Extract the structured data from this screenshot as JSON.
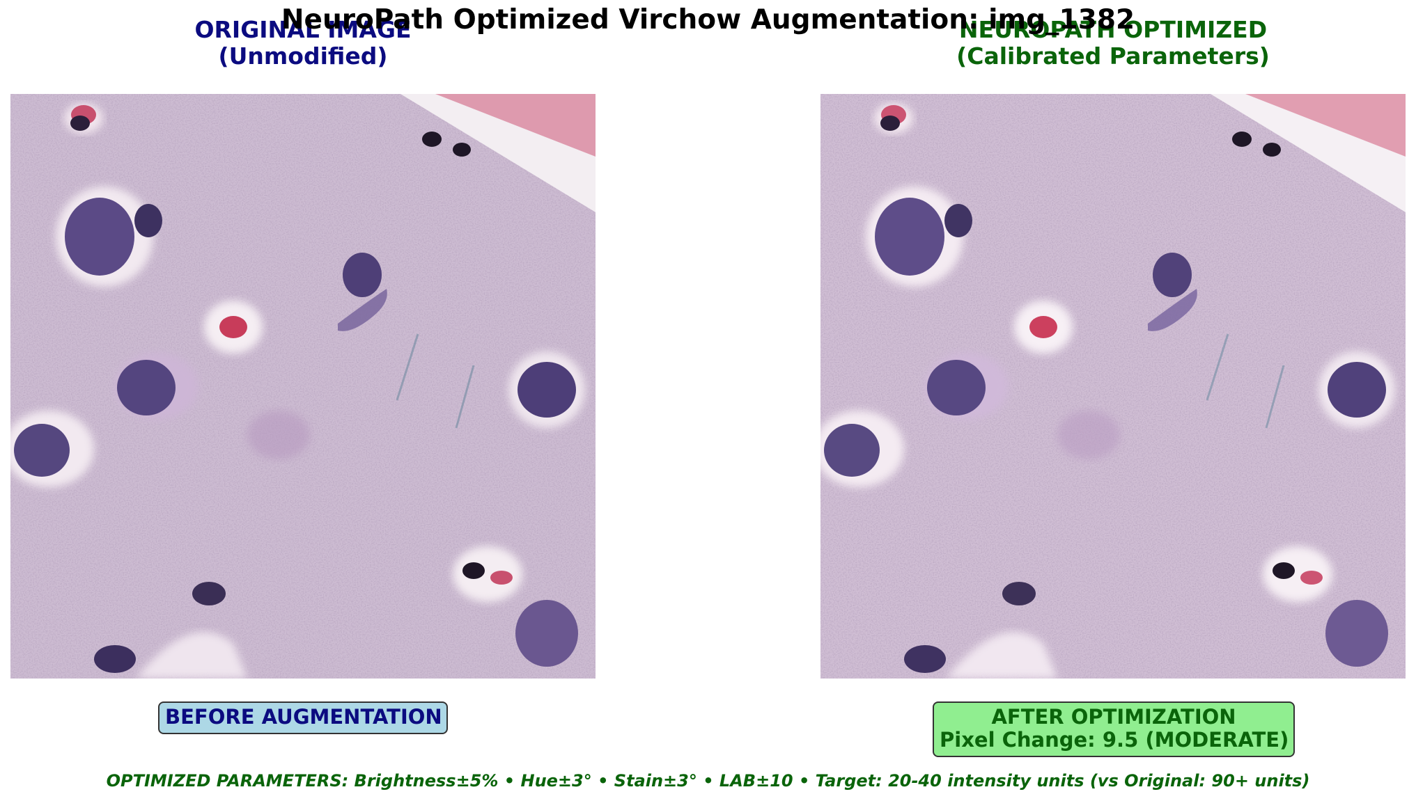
{
  "figure": {
    "title": "NeuroPath Optimized Virchow Augmentation: img_1382"
  },
  "left_panel": {
    "title_line1": "ORIGINAL IMAGE",
    "title_line2": "(Unmodified)",
    "badge": "BEFORE AUGMENTATION",
    "title_color": "#0b0b80",
    "badge_background": "#add8e6"
  },
  "right_panel": {
    "title_line1": "NEUROPATH OPTIMIZED",
    "title_line2": "(Calibrated Parameters)",
    "badge_line1": "AFTER OPTIMIZATION",
    "badge_line2": "Pixel Change: 9.5 (MODERATE)",
    "title_color": "#0a640a",
    "badge_background": "#90ee90"
  },
  "footer": {
    "text": "OPTIMIZED PARAMETERS: Brightness±5% • Hue±3° • Stain±3° • LAB±10 • Target: 20-40 intensity units (vs Original: 90+ units)"
  },
  "colors": {
    "tissue_background": "#cbb8cf",
    "nucleus": "#5a4a80",
    "red_blood_cell": "#c83c5a"
  }
}
